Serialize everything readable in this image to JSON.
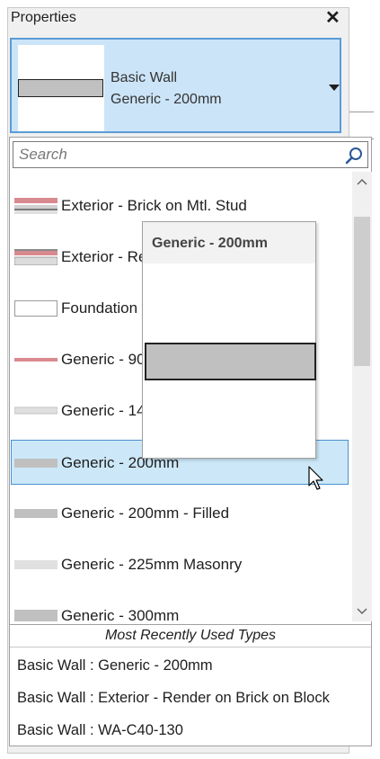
{
  "panel": {
    "title": "Properties"
  },
  "type_selector": {
    "family": "Basic Wall",
    "type": "Generic - 200mm"
  },
  "search": {
    "placeholder": "Search"
  },
  "types": [
    {
      "label": "Exterior - Brick on Mtl. Stud",
      "swatch": "brick-stud"
    },
    {
      "label": "Exterior - Re",
      "swatch": "brick-block"
    },
    {
      "label": "Foundation",
      "swatch": "foundation"
    },
    {
      "label": "Generic - 90",
      "swatch": "red-line"
    },
    {
      "label": "Generic - 14",
      "swatch": "light-thin"
    },
    {
      "label": "Generic - 200mm",
      "swatch": "grey",
      "selected": true
    },
    {
      "label": "Generic - 200mm - Filled",
      "swatch": "grey"
    },
    {
      "label": "Generic - 225mm Masonry",
      "swatch": "light"
    },
    {
      "label": "Generic - 300mm",
      "swatch": "grey-thick"
    }
  ],
  "tooltip": {
    "title": "Generic - 200mm"
  },
  "mru": {
    "header": "Most Recently Used Types",
    "items": [
      "Basic Wall : Generic - 200mm",
      "Basic Wall : Exterior - Render on Brick on Block",
      "Basic Wall : WA-C40-130"
    ]
  },
  "colors": {
    "selection": "#cce4f7",
    "selection_border": "#5b9bd5",
    "brick": "#d98a8f",
    "wall_grey": "#c0c0c0"
  },
  "icons": {
    "close": "close-icon",
    "search": "search-icon",
    "dropdown": "chevron-down-icon",
    "scroll_up": "chevron-up-icon",
    "scroll_down": "chevron-down-icon"
  }
}
